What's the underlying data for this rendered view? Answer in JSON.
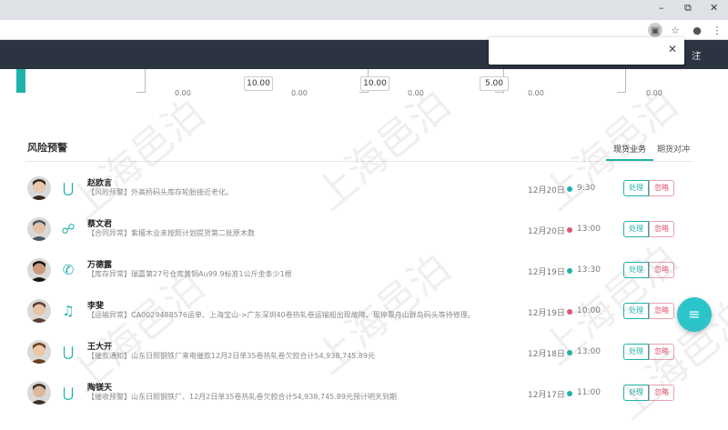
{
  "browser": {
    "minimize": "–",
    "maximize": "⧉",
    "close": "✕"
  },
  "popup": {
    "input_value": "",
    "close": "✕"
  },
  "header": {
    "user_label": "注",
    "chevron": "⌄"
  },
  "gauges": {
    "values": [
      "10.00",
      "10.00",
      "5.00"
    ],
    "zeros": [
      "0.00",
      "0.00",
      "0.00",
      "0.00",
      "0.00"
    ]
  },
  "risk": {
    "title": "风险预警",
    "tabs": [
      "现货业务",
      "期货对冲"
    ],
    "handle_label": "处理",
    "ignore_label": "忽略",
    "items": [
      {
        "name": "赵欧言",
        "desc": "【风险预警】外高桥码头库存轮胎接近老化。",
        "date": "12月20日",
        "time": "9:30",
        "dot": "#20b2aa",
        "icon": "magnet-icon"
      },
      {
        "name": "蔡文君",
        "desc": "【合同异常】紫檀木业未按照计划提货第二批原木数",
        "date": "12月20日",
        "time": "13:00",
        "dot": "#e05570",
        "icon": "chat-icon"
      },
      {
        "name": "万德露",
        "desc": "【库存异常】瑞嘉第27号仓库黄铜Au99.9标准1公斤金条少1根",
        "date": "12月19日",
        "time": "13:30",
        "dot": "#20b2aa",
        "icon": "phone-icon"
      },
      {
        "name": "李斐",
        "desc": "【运输异常】CA0029488576运单、上海宝山->广东深圳40卷热轧卷运输船出现故障、现停靠舟山群岛码头等待修理。",
        "date": "12月19日",
        "time": "10:00",
        "dot": "#e05570",
        "icon": "bell-icon"
      },
      {
        "name": "王大开",
        "desc": "【催款通知】山东日照钢铁厂来电催款12月2日单35卷热轧卷欠款合计54,938,745.89元",
        "date": "12月18日",
        "time": "13:00",
        "dot": "#20b2aa",
        "icon": "magnet-icon"
      },
      {
        "name": "陶镁天",
        "desc": "【催收预警】山东日照钢铁厂、12月2日单35卷热轧卷欠款合计54,938,745.89元预计明天到期",
        "date": "12月17日",
        "time": "11:00",
        "dot": "#20b2aa",
        "icon": "magnet-icon"
      }
    ]
  },
  "fab": {
    "icon": "≡"
  },
  "watermark": "上海邑泊"
}
